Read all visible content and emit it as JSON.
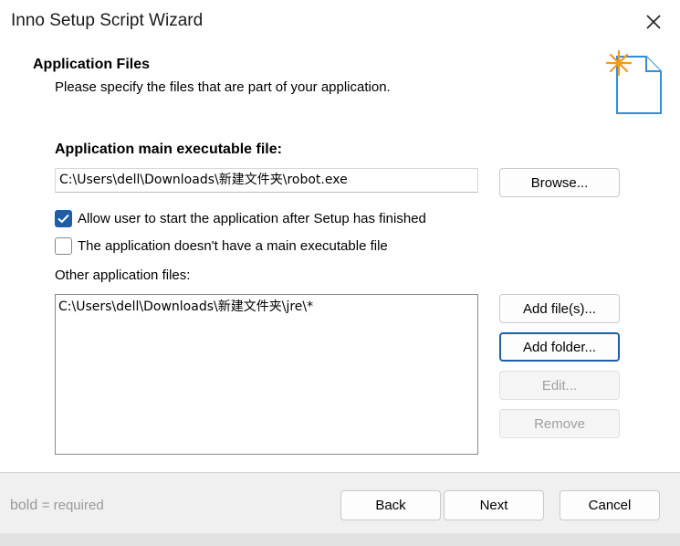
{
  "window": {
    "title": "Inno Setup Script Wizard",
    "close_icon": "close-icon"
  },
  "header": {
    "title": "Application Files",
    "description": "Please specify the files that are part of your application.",
    "icon": "new-file-sparkle-icon"
  },
  "main_exe": {
    "label": "Application main executable file:",
    "value": "C:\\Users\\dell\\Downloads\\新建文件夹\\robot.exe",
    "browse_label": "Browse..."
  },
  "options": [
    {
      "label": "Allow user to start the application after Setup has finished",
      "checked": true
    },
    {
      "label": "The application doesn't have a main executable file",
      "checked": false
    }
  ],
  "other_files": {
    "label": "Other application files:",
    "items": [
      "C:\\Users\\dell\\Downloads\\新建文件夹\\jre\\*"
    ],
    "add_files_label": "Add file(s)...",
    "add_folder_label": "Add folder...",
    "edit_label": "Edit...",
    "remove_label": "Remove"
  },
  "footer": {
    "legend_bold": "bold",
    "legend_rest": "= required",
    "back_label": "Back",
    "next_label": "Next",
    "cancel_label": "Cancel"
  },
  "colors": {
    "accent": "#1d5ea8",
    "sparkle": "#f39a1e",
    "icon_outline": "#2f8fd8"
  }
}
